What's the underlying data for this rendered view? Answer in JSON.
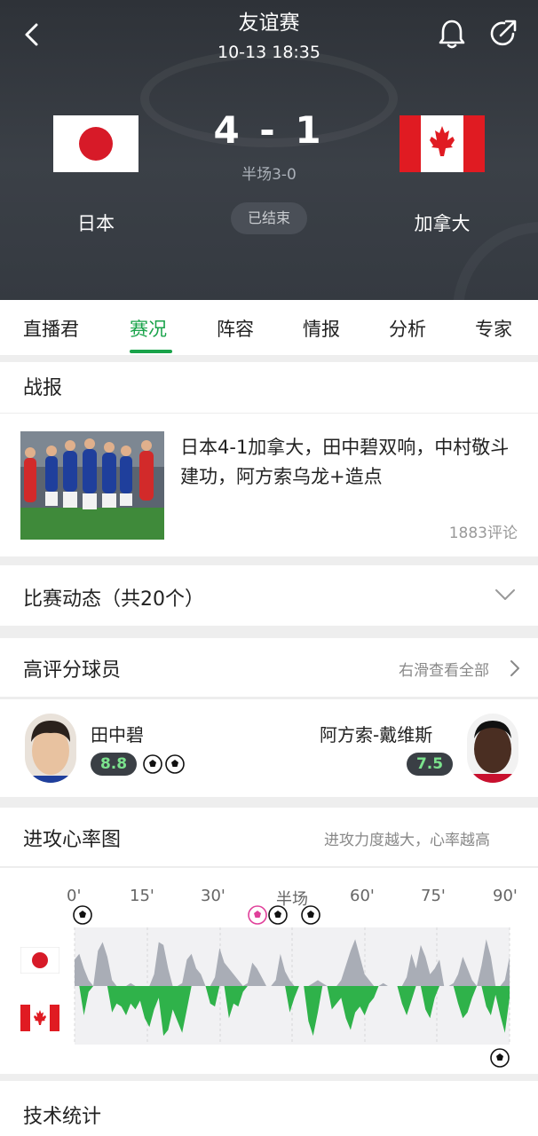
{
  "header": {
    "title": "友谊赛",
    "time": "10-13 18:35",
    "home_team": "日本",
    "away_team": "加拿大",
    "score": "4 - 1",
    "half_score": "半场3-0",
    "status": "已结束"
  },
  "tabs": [
    "直播君",
    "赛况",
    "阵容",
    "情报",
    "分析",
    "专家"
  ],
  "active_tab": "赛况",
  "report": {
    "heading": "战报",
    "headline": "日本4-1加拿大，田中碧双响，中村敬斗建功，阿方索乌龙+造点",
    "comments": "1883评论"
  },
  "events": {
    "label": "比赛动态（共20个）"
  },
  "top_players": {
    "heading": "高评分球员",
    "hint": "右滑查看全部",
    "home": {
      "name": "田中碧",
      "rating": "8.8",
      "goals": 2
    },
    "away": {
      "name": "阿方索-戴维斯",
      "rating": "7.5"
    }
  },
  "momentum": {
    "heading": "进攻心率图",
    "hint": "进攻力度越大，心率越高",
    "ticks": [
      "0'",
      "15'",
      "30'",
      "半场",
      "60'",
      "75'",
      "90'"
    ],
    "home_values": [
      0.45,
      0.55,
      0.3,
      0.1,
      0.0,
      0.6,
      0.75,
      0.5,
      0.1,
      0.0,
      0.0,
      0.0,
      0.05,
      0.0,
      0.0,
      0.0,
      0.0,
      0.2,
      0.75,
      0.7,
      0.3,
      0.0,
      0.0,
      0.05,
      0.45,
      0.55,
      0.3,
      0.2,
      0.0,
      0.0,
      0.15,
      0.65,
      0.4,
      0.3,
      0.2,
      0.1,
      0.0,
      0.05,
      0.4,
      0.3,
      0.15,
      0.0,
      0.0,
      0.1,
      0.55,
      0.25,
      0.1,
      0.0,
      0.0,
      0.0,
      0.0,
      0.05,
      0.1,
      0.05,
      0.0,
      0.0,
      0.0,
      0.1,
      0.35,
      0.6,
      0.8,
      0.5,
      0.2,
      0.1,
      0.0,
      0.0,
      0.05,
      0.0,
      0.0,
      0.0,
      0.0,
      0.15,
      0.55,
      0.3,
      0.7,
      0.5,
      0.2,
      0.3,
      0.45,
      0.0,
      0.0,
      0.05,
      0.2,
      0.5,
      0.3,
      0.1,
      0.0,
      0.35,
      0.8,
      0.5,
      0.0,
      0.0,
      0.1,
      0.5
    ],
    "away_values": [
      0.0,
      0.0,
      0.5,
      0.1,
      0.0,
      0.0,
      0.0,
      0.0,
      0.45,
      0.3,
      0.35,
      0.5,
      0.3,
      0.4,
      0.25,
      0.55,
      0.7,
      0.4,
      0.2,
      0.85,
      0.75,
      0.4,
      0.6,
      0.8,
      0.4,
      0.0,
      0.0,
      0.0,
      0.0,
      0.3,
      0.35,
      0.0,
      0.0,
      0.55,
      0.3,
      0.35,
      0.1,
      0.0,
      0.0,
      0.0,
      0.0,
      0.0,
      0.0,
      0.0,
      0.0,
      0.0,
      0.45,
      0.2,
      0.0,
      0.0,
      0.6,
      0.85,
      0.45,
      0.0,
      0.0,
      0.4,
      0.3,
      0.2,
      0.55,
      0.75,
      0.45,
      0.35,
      0.5,
      0.3,
      0.2,
      0.0,
      0.0,
      0.0,
      0.0,
      0.0,
      0.3,
      0.5,
      0.25,
      0.0,
      0.0,
      0.4,
      0.55,
      0.2,
      0.0,
      0.0,
      0.0,
      0.0,
      0.3,
      0.55,
      0.45,
      0.2,
      0.0,
      0.0,
      0.35,
      0.5,
      0.15,
      0.5,
      0.8,
      0.2
    ]
  },
  "stats": {
    "heading": "技术统计"
  },
  "colors": {
    "accent": "#19a34a",
    "home_area": "#a9adb6",
    "away_area": "#2fb24a"
  }
}
